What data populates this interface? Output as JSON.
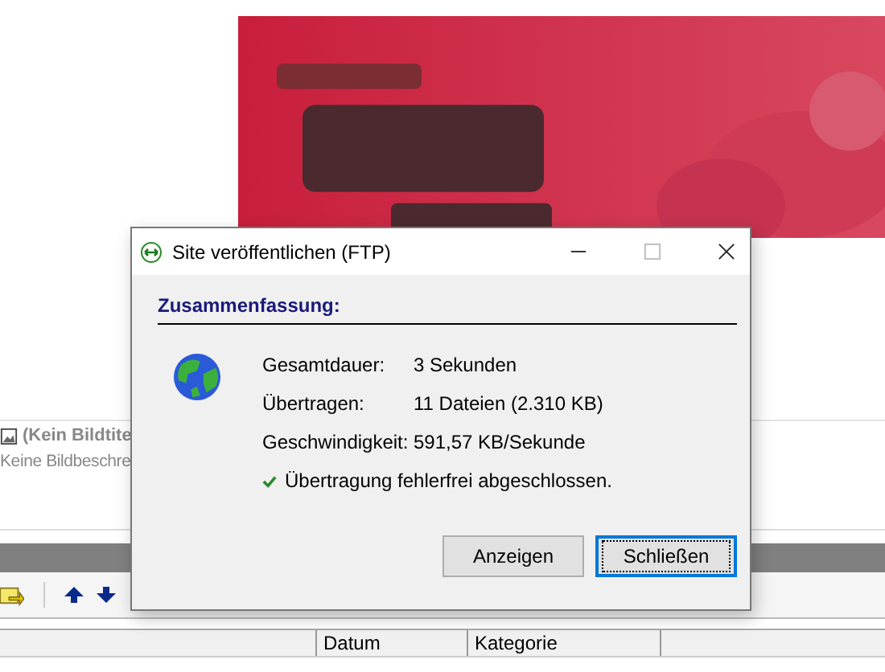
{
  "image_list": {
    "items": [
      {
        "title": "(Kein Bildtite",
        "description": "Keine Bildbeschre"
      }
    ]
  },
  "table": {
    "columns": [
      "Datum",
      "Kategorie"
    ]
  },
  "dialog": {
    "title": "Site veröffentlichen (FTP)",
    "heading": "Zusammenfassung:",
    "rows": [
      {
        "label": "Gesamtdauer:",
        "value": "3 Sekunden"
      },
      {
        "label": "Übertragen:",
        "value": "11 Dateien (2.310 KB)"
      },
      {
        "label": "Geschwindigkeit:",
        "value": "591,57 KB/Sekunde"
      }
    ],
    "status": "Übertragung fehlerfrei abgeschlossen.",
    "buttons": [
      {
        "label": "Anzeigen",
        "focused": false
      },
      {
        "label": "Schließen",
        "focused": true
      }
    ]
  }
}
